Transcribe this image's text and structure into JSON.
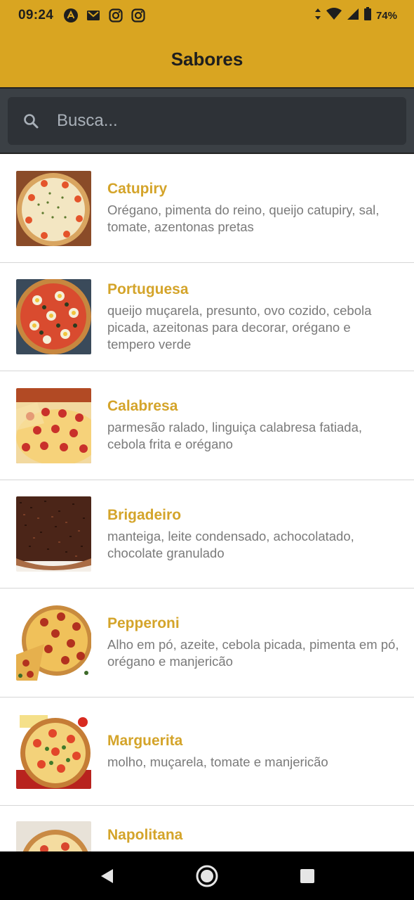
{
  "status_bar": {
    "time": "09:24",
    "battery": "74%",
    "icons": [
      "aptoide-icon",
      "gmail-icon",
      "instagram-icon",
      "instagram-icon",
      "data-arrows-icon",
      "wifi-icon",
      "signal-icon",
      "battery-icon"
    ]
  },
  "app_bar": {
    "title": "Sabores"
  },
  "search": {
    "placeholder": "Busca...",
    "value": ""
  },
  "flavors": [
    {
      "name": "Catupiry",
      "ingredients": "Orégano, pimenta do reino, queijo catupiry, sal, tomate, azentonas pretas"
    },
    {
      "name": "Portuguesa",
      "ingredients": "queijo muçarela, presunto, ovo cozido, cebola picada, azeitonas para decorar, orégano e tempero verde"
    },
    {
      "name": "Calabresa",
      "ingredients": "parmesão ralado, linguiça calabresa fatiada, cebola frita e orégano"
    },
    {
      "name": "Brigadeiro",
      "ingredients": "manteiga, leite condensado, achocolatado, chocolate granulado"
    },
    {
      "name": "Pepperoni",
      "ingredients": "Alho em pó, azeite, cebola picada, pimenta em pó, orégano e manjericão"
    },
    {
      "name": "Marguerita",
      "ingredients": "molho, muçarela, tomate e manjericão"
    },
    {
      "name": "Napolitana",
      "ingredients": ""
    }
  ],
  "colors": {
    "accent": "#d9a521",
    "title_text": "#d4a42a",
    "desc_text": "#7a7a7a",
    "search_bg": "#3b4045"
  },
  "nav": {
    "icons": [
      "back-icon",
      "home-icon",
      "recents-icon"
    ]
  }
}
